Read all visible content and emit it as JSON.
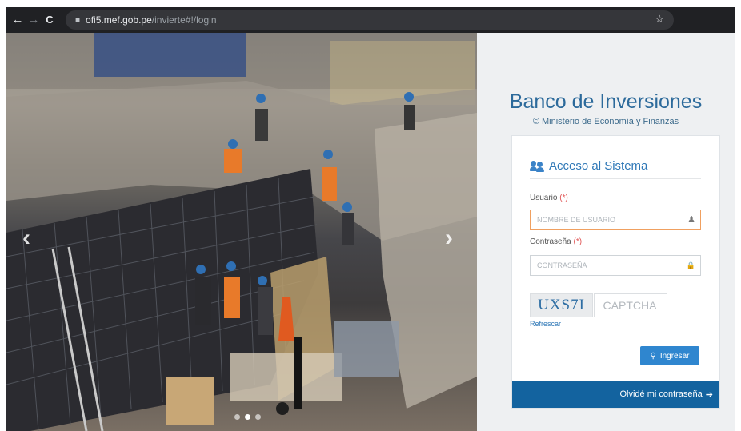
{
  "browser": {
    "url_host": "ofi5.mef.gob.pe",
    "url_path": "/invierte#!/login"
  },
  "icons": {
    "back": "←",
    "forward": "→",
    "reload": "C",
    "lock": "■",
    "star": "☆",
    "slide_prev": "‹",
    "slide_next": "›",
    "user": "♟",
    "padlock": "🔒",
    "key": "⚲",
    "arrow_right": "➔"
  },
  "brand": {
    "title": "Banco de Inversiones",
    "subtitle": "© Ministerio de Economía y Finanzas"
  },
  "login": {
    "header": "Acceso al Sistema",
    "username_label": "Usuario",
    "username_placeholder": "NOMBRE DE USUARIO",
    "password_label": "Contraseña",
    "password_placeholder": "CONTRASEÑA",
    "required_mark": "(*)",
    "captcha_code": "UXS7I",
    "captcha_placeholder": "CAPTCHA",
    "refresh_label": "Refrescar",
    "submit_label": "Ingresar",
    "forgot_label": "Olvidé mi contraseña"
  },
  "carousel": {
    "slide_count": 3,
    "active_slide": 1
  },
  "colors": {
    "chrome_bg": "#202124",
    "primary": "#2f86cf",
    "brand_blue": "#2c6a9b",
    "footer_bar": "#13639f",
    "focus_border": "#f0a060",
    "required": "#e05454"
  }
}
